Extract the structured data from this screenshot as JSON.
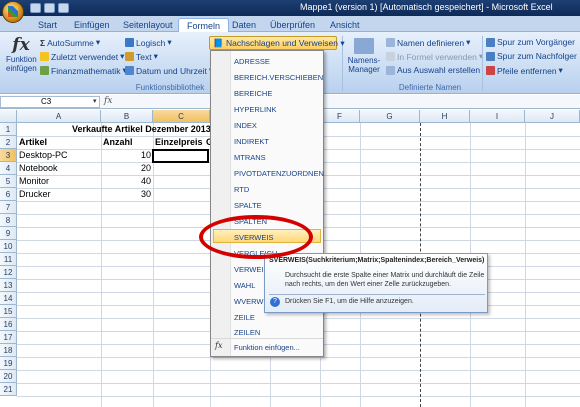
{
  "window": {
    "title": "Mappe1 (version 1) [Automatisch gespeichert] - Microsoft Excel"
  },
  "tabs": [
    "Start",
    "Einfügen",
    "Seitenlayout",
    "Formeln",
    "Daten",
    "Überprüfen",
    "Ansicht"
  ],
  "ribbon": {
    "funktion_einfuegen": "Funktion einfügen",
    "autosumme": "AutoSumme",
    "zuletzt": "Zuletzt verwendet",
    "finanz": "Finanzmathematik",
    "logisch": "Logisch",
    "text": "Text",
    "datum": "Datum und Uhrzeit",
    "nachschlagen": "Nachschlagen und Verweisen",
    "group_funktionsbibliothek": "Funktionsbibliothek",
    "namens_manager": "Namens-Manager",
    "namen_definieren": "Namen definieren",
    "in_formel": "In Formel verwenden",
    "aus_auswahl": "Aus Auswahl erstellen",
    "group_definierte_namen": "Definierte Namen",
    "spur_vorgaenger": "Spur zum Vorgänger",
    "spur_nachfolger": "Spur zum Nachfolger",
    "pfeile": "Pfeile entfernen"
  },
  "formula_bar": {
    "namebox": "C3",
    "fx": "fx"
  },
  "sheet": {
    "columns": [
      "A",
      "B",
      "C",
      "D",
      "E",
      "F",
      "G",
      "H",
      "I",
      "J"
    ],
    "rows": [
      "1",
      "2",
      "3",
      "4",
      "5",
      "6",
      "7",
      "8",
      "9",
      "10",
      "11",
      "12",
      "13",
      "14",
      "15",
      "16",
      "17",
      "18",
      "19",
      "20",
      "21"
    ],
    "title": "Verkaufte Artikel Dezember 2013",
    "header": {
      "artikel": "Artikel",
      "anzahl": "Anzahl",
      "einzelpreis": "Einzelpreis",
      "cut": "G"
    },
    "items": [
      {
        "name": "Desktop-PC",
        "anzahl": "10"
      },
      {
        "name": "Notebook",
        "anzahl": "20"
      },
      {
        "name": "Monitor",
        "anzahl": "40"
      },
      {
        "name": "Drucker",
        "anzahl": "30"
      }
    ]
  },
  "menu": {
    "items": [
      "ADRESSE",
      "BEREICH.VERSCHIEBEN",
      "BEREICHE",
      "HYPERLINK",
      "INDEX",
      "INDIREKT",
      "MTRANS",
      "PIVOTDATENZUORDNEN",
      "RTD",
      "SPALTE",
      "SPALTEN",
      "SVERWEIS",
      "VERGLEICH",
      "VERWEIS",
      "WAHL",
      "WVERWEIS",
      "ZEILE",
      "ZEILEN"
    ],
    "insert_function": "Funktion einfügen..."
  },
  "tooltip": {
    "title": "SVERWEIS(Suchkriterium;Matrix;Spaltenindex;Bereich_Verweis)",
    "description": "Durchsucht die erste Spalte einer Matrix und durchläuft die Zeile nach rechts, um den Wert einer Zelle zurückzugeben.",
    "help": "Drücken Sie F1, um die Hilfe anzuzeigen."
  },
  "colors": {
    "annotation": "#d40000",
    "highlight": "#ffd776",
    "ribbon": "#c6daf2"
  }
}
